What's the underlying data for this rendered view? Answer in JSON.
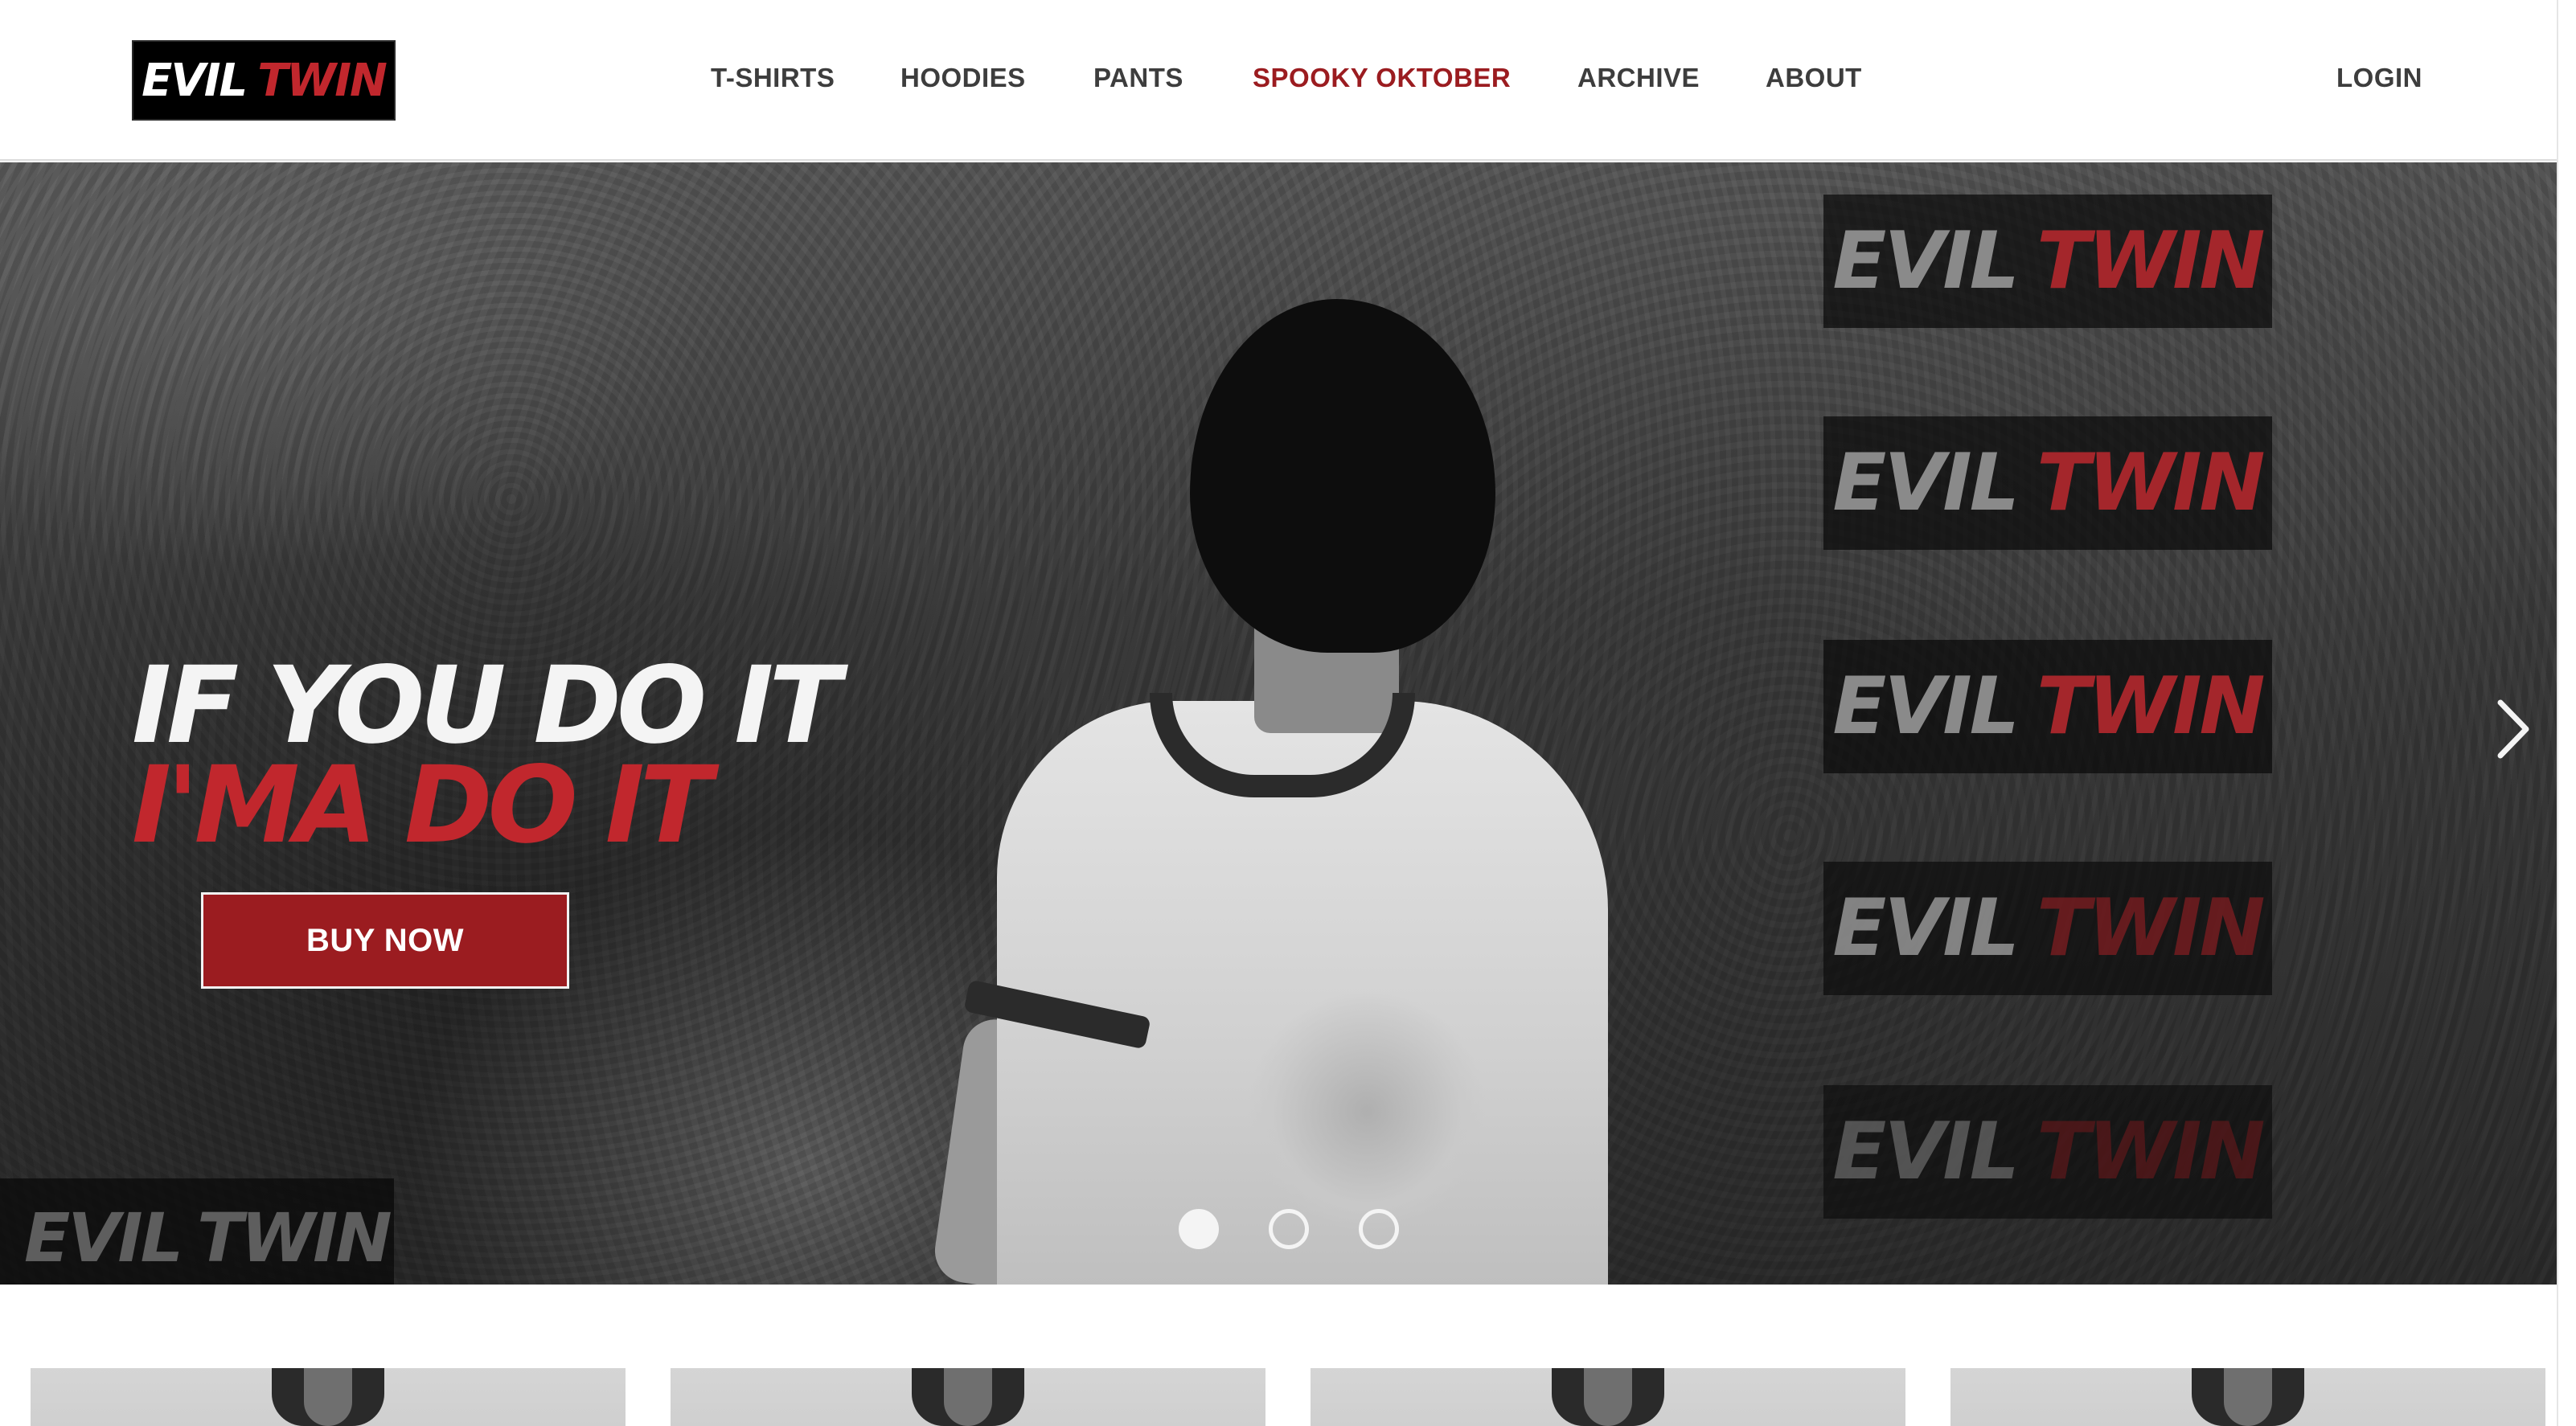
{
  "brand": {
    "word1": "EVIL",
    "word2": "TWIN",
    "accent_color": "#c1272d",
    "dark_accent_color": "#9b1c20"
  },
  "nav": {
    "items": [
      {
        "label": "T-SHIRTS"
      },
      {
        "label": "HOODIES"
      },
      {
        "label": "PANTS"
      },
      {
        "label": "SPOOKY OKTOBER",
        "highlighted": true
      },
      {
        "label": "ARCHIVE"
      },
      {
        "label": "ABOUT"
      }
    ],
    "login_label": "LOGIN"
  },
  "hero": {
    "headline_line1": "IF YOU DO IT",
    "headline_line2": "I'MA DO IT",
    "cta_label": "BUY NOW",
    "next_icon": "chevron-right-icon",
    "slides": {
      "count": 3,
      "active_index": 0
    },
    "side_logo_tiles": 5
  },
  "products": {
    "visible_cards": 4
  }
}
